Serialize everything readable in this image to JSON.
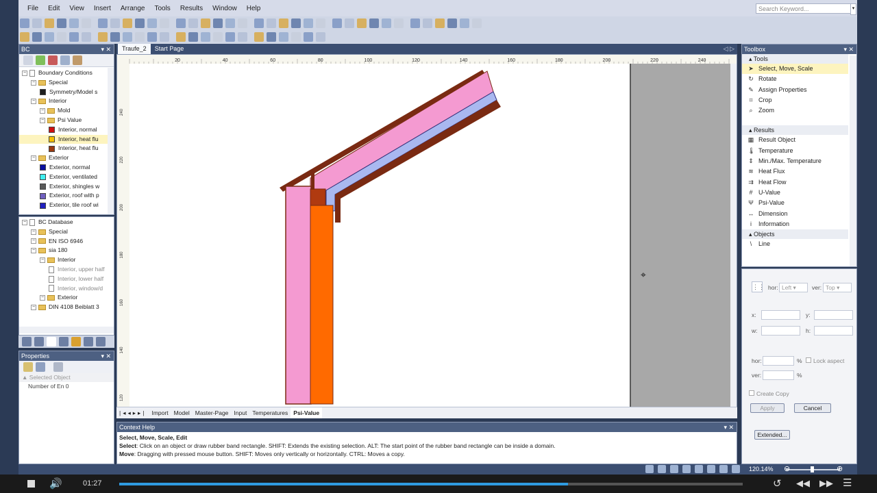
{
  "menu": [
    "File",
    "Edit",
    "View",
    "Insert",
    "Arrange",
    "Tools",
    "Results",
    "Window",
    "Help"
  ],
  "search": {
    "placeholder": "Search Keyword..."
  },
  "bc_panel": {
    "title": "BC",
    "items": [
      {
        "label": "Boundary Conditions",
        "level": 0,
        "type": "doc"
      },
      {
        "label": "Special",
        "level": 1,
        "type": "folder"
      },
      {
        "label": "Symmetry/Model s",
        "level": 2,
        "type": "color",
        "color": "#1e1e1e"
      },
      {
        "label": "Interior",
        "level": 1,
        "type": "folder"
      },
      {
        "label": "Mold",
        "level": 2,
        "type": "folder"
      },
      {
        "label": "Psi Value",
        "level": 2,
        "type": "folder"
      },
      {
        "label": "Interior, normal",
        "level": 3,
        "type": "color",
        "color": "#d01010"
      },
      {
        "label": "Interior, heat flu",
        "level": 3,
        "type": "color",
        "color": "#f5c000",
        "selected": true
      },
      {
        "label": "Interior, heat flu",
        "level": 3,
        "type": "color",
        "color": "#9a3a10"
      },
      {
        "label": "Exterior",
        "level": 1,
        "type": "folder"
      },
      {
        "label": "Exterior, normal",
        "level": 2,
        "type": "color",
        "color": "#0a10a0"
      },
      {
        "label": "Exterior, ventilated",
        "level": 2,
        "type": "color",
        "color": "#40f0f0"
      },
      {
        "label": "Exterior, shingles w",
        "level": 2,
        "type": "color",
        "color": "#5a5a5a"
      },
      {
        "label": "Exterior, roof with p",
        "level": 2,
        "type": "color",
        "color": "#7060c0"
      },
      {
        "label": "Exterior, tile roof wi",
        "level": 2,
        "type": "color",
        "color": "#2020c0"
      }
    ]
  },
  "bcdb_panel": {
    "items": [
      {
        "label": "BC Database",
        "level": 0,
        "type": "doc"
      },
      {
        "label": "Special",
        "level": 1,
        "type": "folder"
      },
      {
        "label": "EN ISO 6946",
        "level": 1,
        "type": "folder"
      },
      {
        "label": "sia 180",
        "level": 1,
        "type": "folder"
      },
      {
        "label": "Interior",
        "level": 2,
        "type": "folder"
      },
      {
        "label": "Interior, upper half",
        "level": 3,
        "type": "doc"
      },
      {
        "label": "Interior, lower half",
        "level": 3,
        "type": "doc"
      },
      {
        "label": "Interior, window/d",
        "level": 3,
        "type": "doc"
      },
      {
        "label": "Exterior",
        "level": 2,
        "type": "folder"
      },
      {
        "label": "DIN 4108 Beiblatt 3",
        "level": 1,
        "type": "folder"
      }
    ]
  },
  "properties": {
    "title": "Properties",
    "section": "Selected Object",
    "row": "Number of En 0"
  },
  "tabs": [
    "Traufe_2",
    "Start Page"
  ],
  "ruler_top": [
    "20",
    "40",
    "60",
    "80",
    "100",
    "120",
    "140",
    "160",
    "180",
    "200",
    "220",
    "240"
  ],
  "ruler_left": [
    "240",
    "220",
    "200",
    "180",
    "160",
    "140",
    "120"
  ],
  "sheet_tabs": [
    "Import",
    "Model",
    "Master-Page",
    "Input",
    "Temperatures",
    "Psi-Value"
  ],
  "context_help": {
    "title": "Context Help",
    "heading": "Select, Move, Scale, Edit",
    "line1_key": "Select",
    "line1": ": Click on an object or draw rubber band rectangle. SHIFT: Extends the existing selection. ALT: The start point of the rubber band rectangle can be inside a domain.",
    "line2_key": "Move",
    "line2": ": Dragging with pressed mouse button. SHIFT: Moves only vertically or horizontally. CTRL: Moves a copy."
  },
  "toolbox": {
    "title": "Toolbox",
    "groups": [
      {
        "name": "Tools",
        "items": [
          {
            "label": "Select, Move, Scale",
            "icon": "arrow-icon",
            "glyph": "➤",
            "selected": true
          },
          {
            "label": "Rotate",
            "icon": "rotate-icon",
            "glyph": "↻"
          },
          {
            "label": "Assign Properties",
            "icon": "assign-icon",
            "glyph": "✎"
          },
          {
            "label": "Crop",
            "icon": "crop-icon",
            "glyph": "⌗"
          },
          {
            "label": "Zoom",
            "icon": "zoom-icon",
            "glyph": "⌕"
          }
        ]
      },
      {
        "name": "Results",
        "items": [
          {
            "label": "Result Object",
            "icon": "result-icon",
            "glyph": "▦"
          },
          {
            "label": "Temperature",
            "icon": "thermometer-icon",
            "glyph": "🌡"
          },
          {
            "label": "Min./Max. Temperature",
            "icon": "minmax-icon",
            "glyph": "⇕"
          },
          {
            "label": "Heat Flux",
            "icon": "heat-flux-icon",
            "glyph": "≋"
          },
          {
            "label": "Heat Flow",
            "icon": "heat-flow-icon",
            "glyph": "⇉"
          },
          {
            "label": "U-Value",
            "icon": "u-value-icon",
            "glyph": "#"
          },
          {
            "label": "Psi-Value",
            "icon": "psi-icon",
            "glyph": "Ψ"
          },
          {
            "label": "Dimension",
            "icon": "dimension-icon",
            "glyph": "↔"
          },
          {
            "label": "Information",
            "icon": "info-icon",
            "glyph": "i"
          }
        ]
      },
      {
        "name": "Objects",
        "items": [
          {
            "label": "Line",
            "icon": "line-icon",
            "glyph": "\\"
          }
        ]
      }
    ]
  },
  "layout": {
    "hor_label": "hor:",
    "hor_value": "Left",
    "ver_label": "ver:",
    "ver_value": "Top",
    "x": "x:",
    "y": "y:",
    "w": "w:",
    "h": "h:",
    "hor_pct": "hor:",
    "ver_pct": "ver:",
    "pct": "%",
    "lock_aspect": "Lock aspect",
    "create_copy": "Create Copy",
    "apply": "Apply",
    "cancel": "Cancel",
    "extended": "Extended..."
  },
  "status": {
    "zoom": "120.14%"
  },
  "video": {
    "time": "01:27",
    "progress": 0.72
  }
}
